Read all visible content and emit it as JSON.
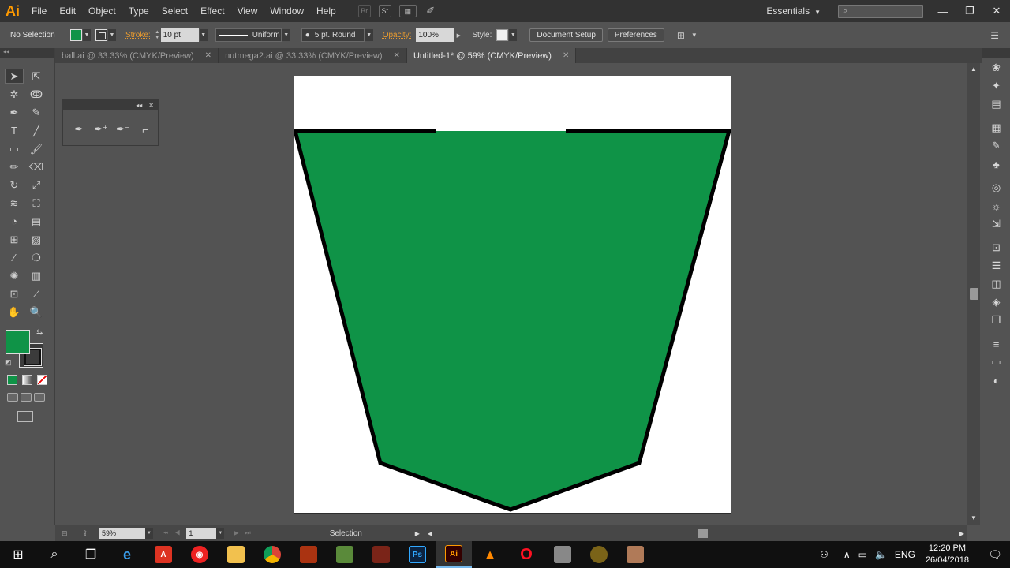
{
  "app": {
    "logo": "Ai",
    "accent": "#ff9a00"
  },
  "menu": [
    "File",
    "Edit",
    "Object",
    "Type",
    "Select",
    "Effect",
    "View",
    "Window",
    "Help"
  ],
  "menu_icons": {
    "bridge": "Br",
    "stock": "St"
  },
  "workspace": {
    "label": "Essentials"
  },
  "search": {
    "placeholder": ""
  },
  "control": {
    "selection": "No Selection",
    "fill_color": "#0f9347",
    "stroke_label": "Stroke:",
    "stroke_weight": "10 pt",
    "profile": "Uniform",
    "brush": "5 pt. Round",
    "opacity_label": "Opacity:",
    "opacity": "100%",
    "style_label": "Style:",
    "doc_setup": "Document Setup",
    "preferences": "Preferences"
  },
  "tabs": [
    {
      "label": "ball.ai @ 33.33% (CMYK/Preview)",
      "active": false
    },
    {
      "label": "nutmega2.ai @ 33.33% (CMYK/Preview)",
      "active": false
    },
    {
      "label": "Untitled-1* @ 59% (CMYK/Preview)",
      "active": true
    }
  ],
  "canvas": {
    "shape_fill": "#0f9347",
    "shape_stroke": "#000000"
  },
  "status": {
    "zoom": "59%",
    "page": "1",
    "tool": "Selection"
  },
  "taskbar": {
    "time": "12:20 PM",
    "date": "26/04/2018",
    "lang": "ENG"
  }
}
